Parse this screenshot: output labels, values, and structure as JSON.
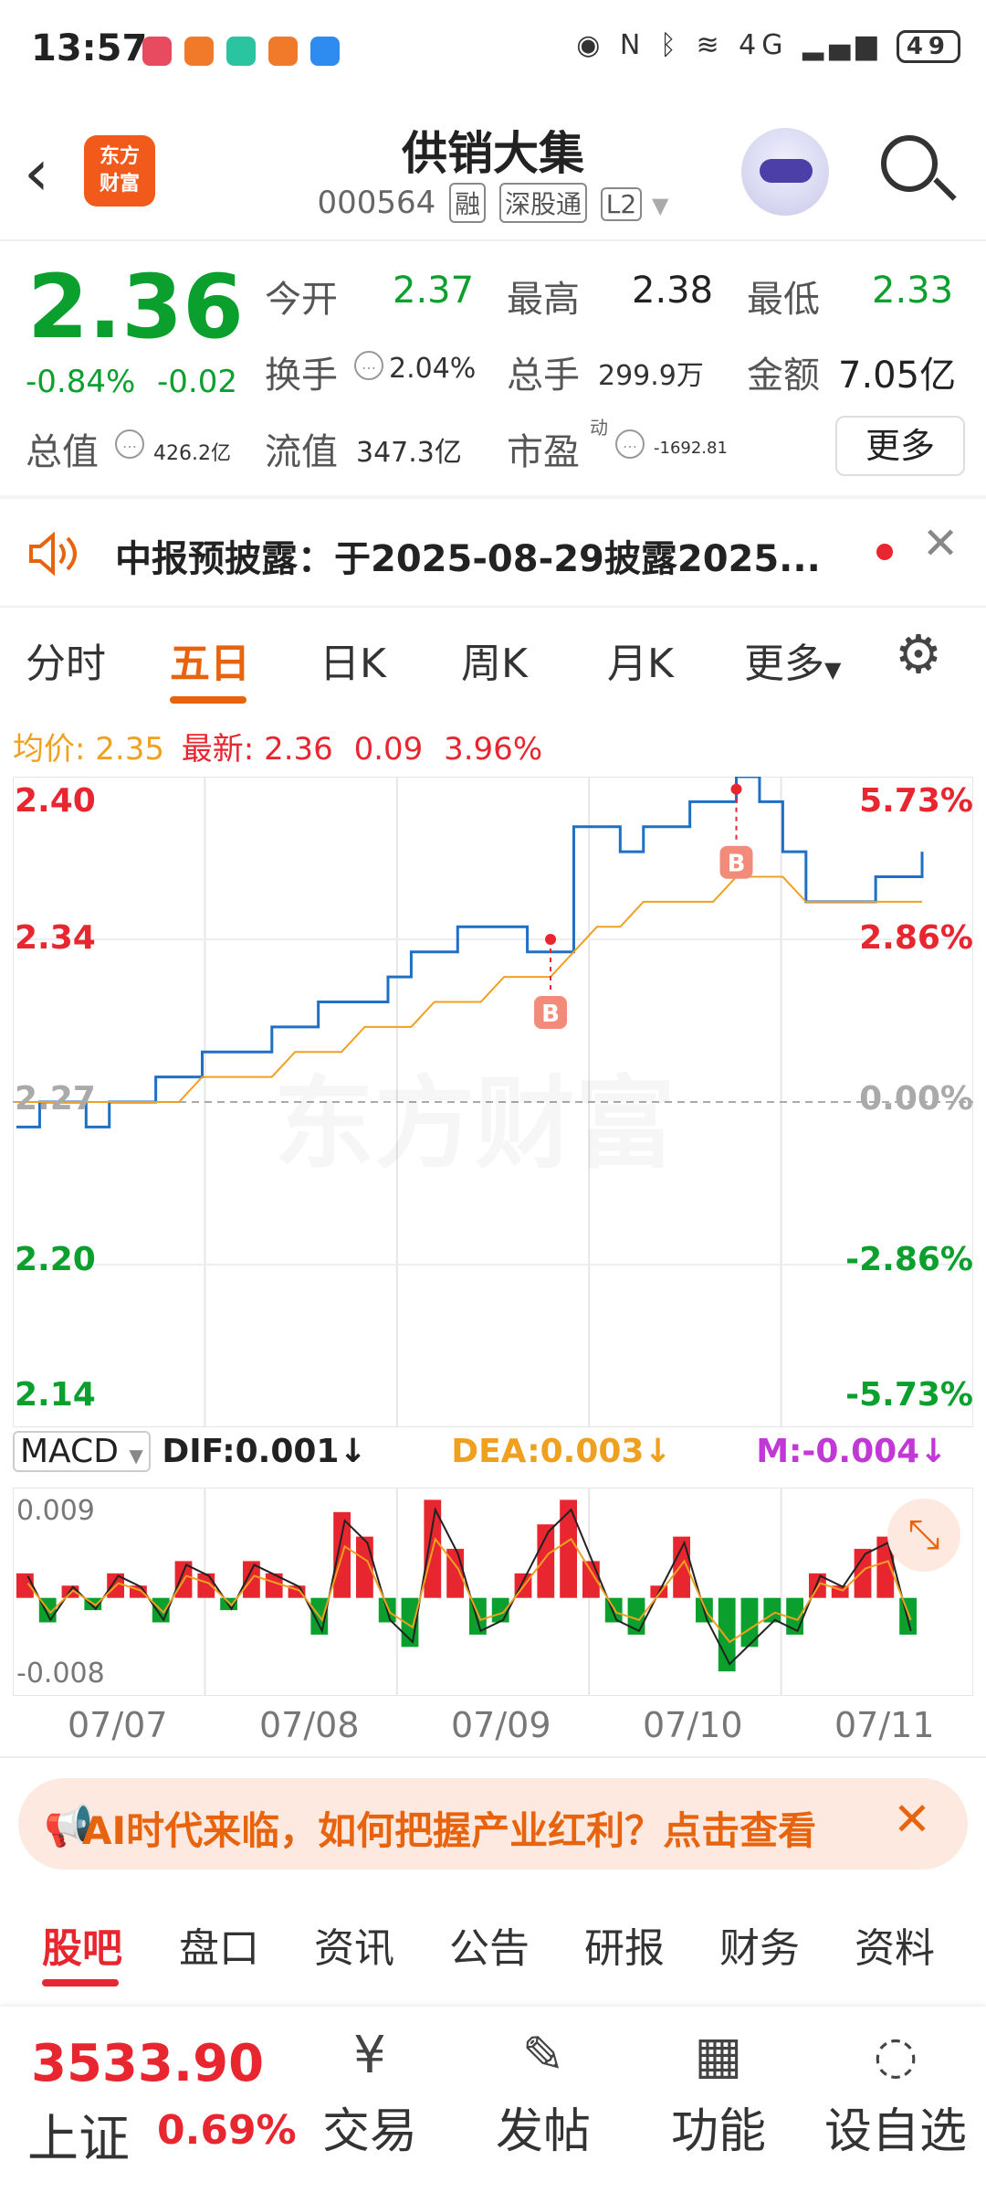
{
  "status_bar": {
    "time": "13:57",
    "network_label": "4G",
    "battery": "49"
  },
  "header": {
    "back_icon": "chevron-left-icon",
    "logo_text": "东方\n财富",
    "title": "供销大集",
    "code": "000564",
    "tags": [
      "融",
      "深股通",
      "L2"
    ]
  },
  "quote": {
    "price": "2.36",
    "change_pct": "-0.84%",
    "change": "-0.02",
    "open_label": "今开",
    "open": "2.37",
    "high_label": "最高",
    "high": "2.38",
    "low_label": "最低",
    "low": "2.33",
    "turnover_label": "换手",
    "turnover": "2.04%",
    "volume_label": "总手",
    "volume": "299.9万",
    "amount_label": "金额",
    "amount": "7.05亿",
    "mktcap_label": "总值",
    "mktcap": "426.2亿",
    "float_label": "流值",
    "float": "347.3亿",
    "pe_label": "市盈",
    "pe_sup": "动",
    "pe": "-1692.81",
    "more_label": "更多"
  },
  "notice": {
    "text": "中报预披露：于2025-08-29披露2025..."
  },
  "chart_tabs": {
    "items": [
      "分时",
      "五日",
      "日K",
      "周K",
      "月K",
      "更多"
    ],
    "active": "五日"
  },
  "legend": {
    "avg_label": "均价:",
    "avg": "2.35",
    "latest_label": "最新:",
    "latest": "2.36",
    "latest_change": "0.09",
    "latest_pct": "3.96%"
  },
  "watermark": "东方财富",
  "chart_data": {
    "type": "line",
    "x_labels": [
      "07/07",
      "07/08",
      "07/09",
      "07/10",
      "07/11"
    ],
    "y_left_ticks": [
      "2.40",
      "2.34",
      "2.27",
      "2.20",
      "2.14"
    ],
    "y_right_ticks": [
      "5.73%",
      "2.86%",
      "0.00%",
      "-2.86%",
      "-5.73%"
    ],
    "ylim": [
      2.14,
      2.4
    ],
    "prev_close": 2.27,
    "series": [
      {
        "name": "最新",
        "color": "#1f6fc5",
        "values": [
          2.26,
          2.27,
          2.27,
          2.26,
          2.27,
          2.27,
          2.28,
          2.28,
          2.29,
          2.29,
          2.29,
          2.3,
          2.3,
          2.31,
          2.31,
          2.31,
          2.32,
          2.33,
          2.33,
          2.34,
          2.34,
          2.34,
          2.33,
          2.33,
          2.38,
          2.38,
          2.37,
          2.38,
          2.38,
          2.39,
          2.39,
          2.4,
          2.39,
          2.37,
          2.35,
          2.35,
          2.35,
          2.36,
          2.36,
          2.37
        ]
      },
      {
        "name": "均价",
        "color": "#f0a020",
        "values": [
          2.27,
          2.27,
          2.27,
          2.27,
          2.27,
          2.27,
          2.27,
          2.27,
          2.28,
          2.28,
          2.28,
          2.28,
          2.29,
          2.29,
          2.29,
          2.3,
          2.3,
          2.3,
          2.31,
          2.31,
          2.31,
          2.32,
          2.32,
          2.32,
          2.33,
          2.34,
          2.34,
          2.35,
          2.35,
          2.35,
          2.35,
          2.36,
          2.36,
          2.36,
          2.35,
          2.35,
          2.35,
          2.35,
          2.35,
          2.35
        ]
      }
    ],
    "markers": [
      {
        "label": "B",
        "x_index": 23,
        "value": 2.335
      },
      {
        "label": "B",
        "x_index": 31,
        "value": 2.395
      }
    ],
    "macd": {
      "selector": "MACD",
      "dif_label": "DIF:0.001↓",
      "dea_label": "DEA:0.003↓",
      "m_label": "M:-0.004↓",
      "ylim": [
        -0.008,
        0.009
      ],
      "top_label": "0.009",
      "bottom_label": "-0.008",
      "bars": [
        0.002,
        -0.002,
        0.001,
        -0.001,
        0.002,
        0.001,
        -0.002,
        0.003,
        0.002,
        -0.001,
        0.003,
        0.002,
        0.001,
        -0.003,
        0.007,
        0.005,
        -0.002,
        -0.004,
        0.008,
        0.004,
        -0.003,
        -0.002,
        0.002,
        0.006,
        0.008,
        0.003,
        -0.002,
        -0.003,
        0.001,
        0.005,
        -0.002,
        -0.006,
        -0.004,
        -0.002,
        -0.003,
        0.002,
        0.001,
        0.004,
        0.005,
        -0.003
      ]
    }
  },
  "banner": {
    "text": "AI时代来临，如何把握产业红利？点击查看"
  },
  "sub_tabs": {
    "items": [
      "股吧",
      "盘口",
      "资讯",
      "公告",
      "研报",
      "财务",
      "资料"
    ],
    "active": "股吧"
  },
  "bottom_bar": {
    "index_value": "3533.90",
    "index_name": "上证",
    "index_pct": "0.69%",
    "nav": [
      {
        "label": "交易",
        "icon": "yen-exchange-icon"
      },
      {
        "label": "发帖",
        "icon": "compose-icon"
      },
      {
        "label": "功能",
        "icon": "grid-icon"
      },
      {
        "label": "设自选",
        "icon": "chat-dots-icon"
      }
    ]
  },
  "colors": {
    "up": "#e8262f",
    "down": "#0ba02e",
    "accent": "#e8630d",
    "price_line": "#1f6fc5",
    "avg_line": "#f0a020",
    "dea_color": "#f0a020",
    "m_color": "#c238d6"
  }
}
